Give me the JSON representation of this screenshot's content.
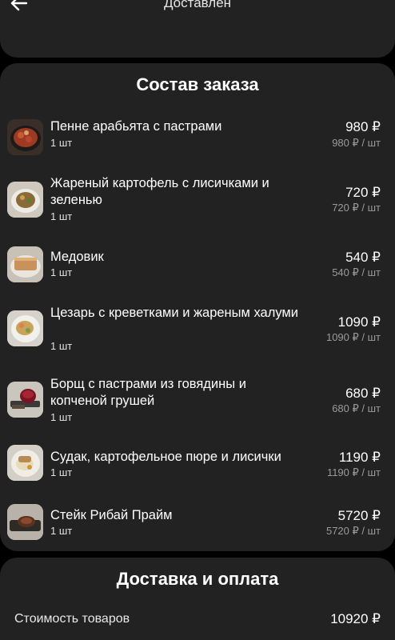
{
  "header": {
    "title": "Доставлен",
    "back_icon": "arrow-left-icon"
  },
  "order": {
    "title": "Состав заказа",
    "items": [
      {
        "name": "Пенне арабьята с пастрами",
        "qty": "1 шт",
        "price": "980 ₽",
        "unit_price": "980 ₽ / шт"
      },
      {
        "name": "Жареный картофель с лисичками и зеленью",
        "qty": "1 шт",
        "price": "720 ₽",
        "unit_price": "720 ₽ / шт"
      },
      {
        "name": "Медовик",
        "qty": "1 шт",
        "price": "540 ₽",
        "unit_price": "540 ₽ / шт"
      },
      {
        "name": "Цезарь с креветками и жареным халуми",
        "qty": "1 шт",
        "price": "1090 ₽",
        "unit_price": "1090 ₽ / шт"
      },
      {
        "name": "Борщ с пастрами из говядины и копченой грушей",
        "qty": "1 шт",
        "price": "680 ₽",
        "unit_price": "680 ₽ / шт"
      },
      {
        "name": "Судак, картофельное пюре и лисички",
        "qty": "1 шт",
        "price": "1190 ₽",
        "unit_price": "1190 ₽ / шт"
      },
      {
        "name": "Стейк Рибай Прайм",
        "qty": "1 шт",
        "price": "5720 ₽",
        "unit_price": "5720 ₽ / шт"
      }
    ]
  },
  "delivery": {
    "title": "Доставка и оплата",
    "goods_cost_label": "Стоимость товаров",
    "goods_cost_value": "10920 ₽"
  },
  "colors": {
    "background": "#000000",
    "card": "#222222",
    "muted_text": "#9a9a9a"
  }
}
